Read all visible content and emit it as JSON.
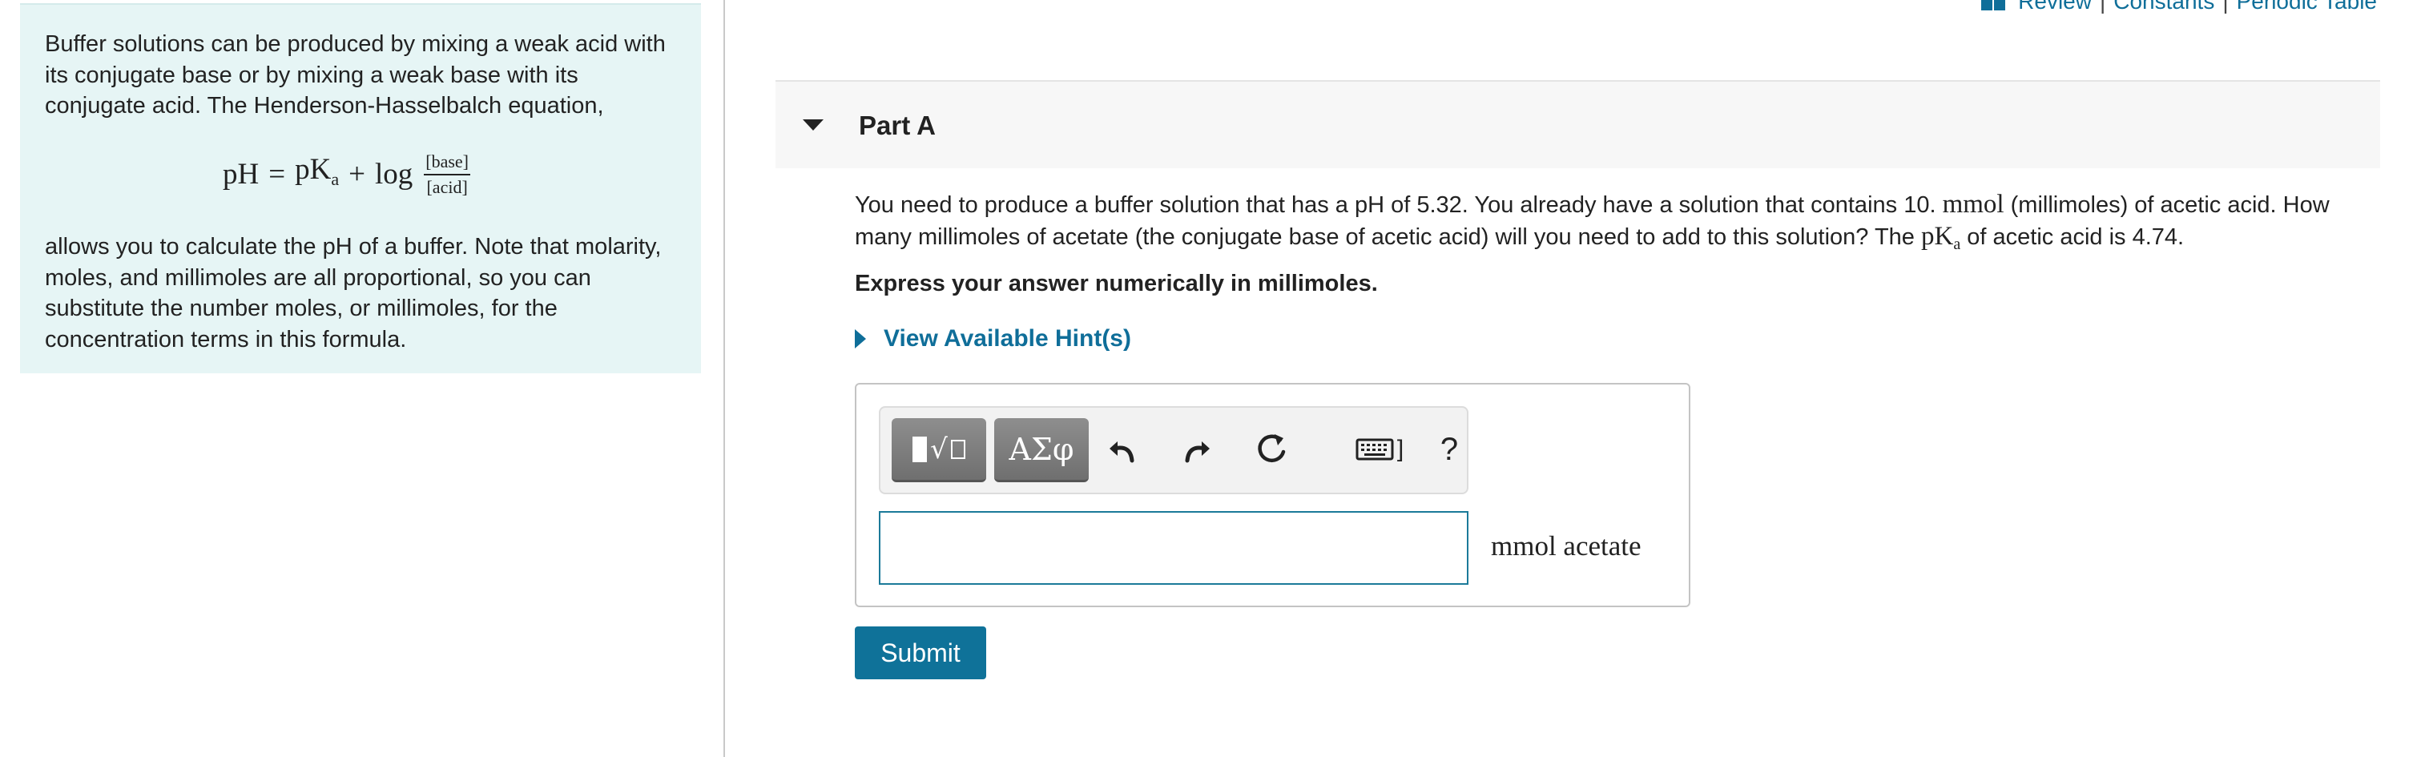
{
  "intro": {
    "paragraph1": "Buffer solutions can be produced by mixing a weak acid with its conjugate base or by mixing a weak base with its conjugate acid. The Henderson-Hasselbalch equation,",
    "equation": {
      "lhs": "pH",
      "eq": "=",
      "pk": "pK",
      "pk_sub": "a",
      "plus": "+",
      "log": "log",
      "numerator": "[base]",
      "denominator": "[acid]"
    },
    "paragraph2": "allows you to calculate the pH of a buffer. Note that molarity, moles, and millimoles are all proportional, so you can substitute the number moles, or millimoles, for the concentration terms in this formula."
  },
  "toplinks": {
    "review": "Review",
    "sep1": "|",
    "constants": "Constants",
    "sep2": "|",
    "periodic": "Periodic Table"
  },
  "part": {
    "title": "Part A"
  },
  "question": {
    "text1": "You need to produce a buffer solution that has a pH of 5.32. You already have a solution that contains 10. ",
    "unit_mmol": "mmol",
    "text2": " (millimoles) of acetic acid. How many millimoles of acetate (the conjugate base of acetic acid) will you need to add to this solution? The ",
    "pk": "pK",
    "pk_sub": "a",
    "text3": " of acetic acid is 4.74.",
    "instruction": "Express your answer numerically in millimoles."
  },
  "hint": {
    "label": "View Available Hint(s)"
  },
  "toolbar": {
    "symbols_label": "ΑΣφ",
    "radical": "√",
    "help_label": "?",
    "kbd_bracket": "]"
  },
  "answer": {
    "value": "",
    "unit": "mmol acetate"
  },
  "submit": {
    "label": "Submit"
  },
  "colors": {
    "accent": "#0f6e99",
    "intro_bg": "#e6f5f5",
    "button_gray": "#7d7d7d"
  }
}
